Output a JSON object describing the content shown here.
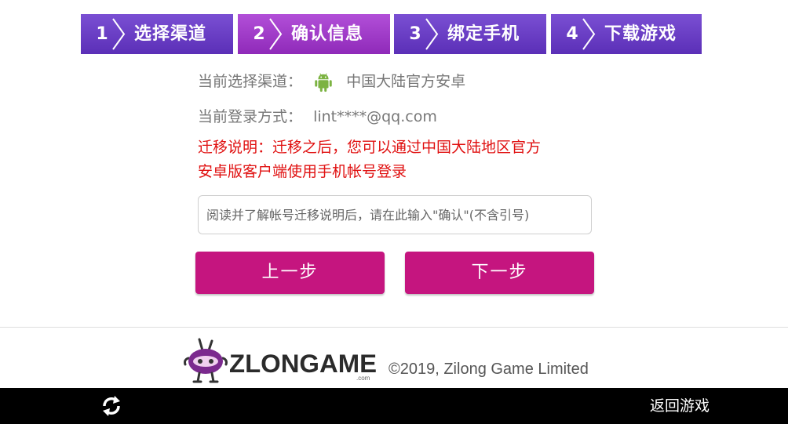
{
  "steps": [
    {
      "num": "1",
      "label": "选择渠道"
    },
    {
      "num": "2",
      "label": "确认信息"
    },
    {
      "num": "3",
      "label": "绑定手机"
    },
    {
      "num": "4",
      "label": "下载游戏"
    }
  ],
  "active_step": 2,
  "info": {
    "channel_label": "当前选择渠道：",
    "channel_value": "中国大陆官方安卓",
    "channel_icon": "android-icon",
    "login_label": "当前登录方式：",
    "login_value": "lint****@qq.com"
  },
  "notice": {
    "line1": "迁移说明：迁移之后，您可以通过中国大陆地区官方",
    "line2": "安卓版客户端使用手机帐号登录"
  },
  "confirm_input": {
    "value": "",
    "placeholder": "阅读并了解帐号迁移说明后，请在此输入\"确认\"(不含引号)"
  },
  "buttons": {
    "prev": "上一步",
    "next": "下一步"
  },
  "footer": {
    "logo_text": "ZLONGAME",
    "logo_sub": ".com",
    "copyright": "©2019, Zilong Game Limited"
  },
  "bottom_bar": {
    "refresh_icon": "refresh-icon",
    "back_label": "返回游戏"
  },
  "colors": {
    "step_bg": "#5b2fb7",
    "step_active_bg": "#8f2ab9",
    "button": "#c5157f",
    "notice": "#e01010",
    "android_green": "#7cb342"
  }
}
